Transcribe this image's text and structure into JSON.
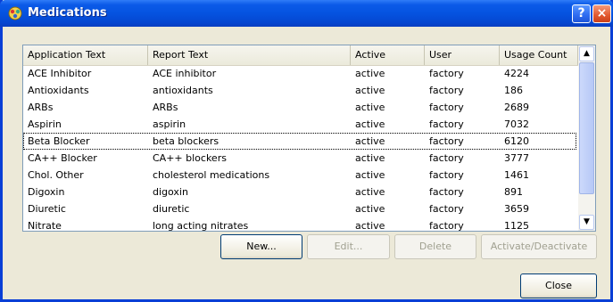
{
  "window": {
    "title": "Medications"
  },
  "columns": [
    "Application Text",
    "Report Text",
    "Active",
    "User",
    "Usage Count"
  ],
  "rows": [
    [
      "ACE Inhibitor",
      "ACE inhibitor",
      "active",
      "factory",
      "4224"
    ],
    [
      "Antioxidants",
      "antioxidants",
      "active",
      "factory",
      "186"
    ],
    [
      "ARBs",
      "ARBs",
      "active",
      "factory",
      "2689"
    ],
    [
      "Aspirin",
      "aspirin",
      "active",
      "factory",
      "7032"
    ],
    [
      "Beta Blocker",
      "beta blockers",
      "active",
      "factory",
      "6120"
    ],
    [
      "CA++ Blocker",
      "CA++ blockers",
      "active",
      "factory",
      "3777"
    ],
    [
      "Chol. Other",
      "cholesterol medications",
      "active",
      "factory",
      "1461"
    ],
    [
      "Digoxin",
      "digoxin",
      "active",
      "factory",
      "891"
    ],
    [
      "Diuretic",
      "diuretic",
      "active",
      "factory",
      "3659"
    ],
    [
      "Nitrate",
      "long acting nitrates",
      "active",
      "factory",
      "1125"
    ]
  ],
  "buttons": {
    "new": "New...",
    "edit": "Edit...",
    "delete": "Delete",
    "activate": "Activate/Deactivate",
    "close": "Close"
  },
  "titlebar_buttons": {
    "help": "?",
    "close": "×"
  },
  "scroll": {
    "up": "▲",
    "down": "▼"
  }
}
